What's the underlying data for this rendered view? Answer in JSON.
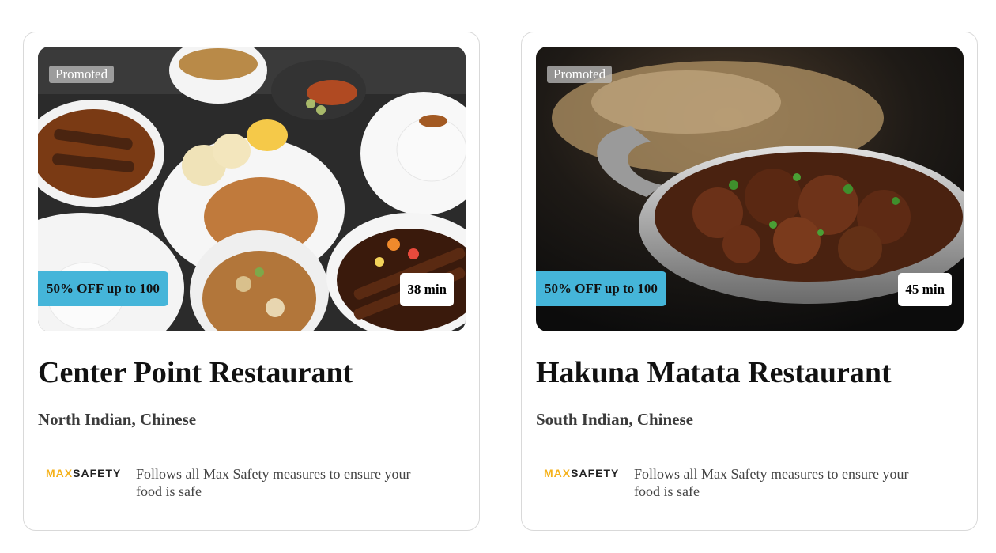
{
  "restaurants": [
    {
      "promoted_label": "Promoted",
      "offer": "50% OFF up to 100",
      "delivery_time": "38 min",
      "name": "Center Point Restaurant",
      "cuisines": "North Indian, Chinese",
      "safety_logo_max": "MAX",
      "safety_logo_safety": "SAFETY",
      "safety_text": "Follows all Max Safety measures to ensure your food is safe"
    },
    {
      "promoted_label": "Promoted",
      "offer": "50% OFF up to 100",
      "delivery_time": "45 min",
      "name": "Hakuna Matata Restaurant",
      "cuisines": "South Indian, Chinese",
      "safety_logo_max": "MAX",
      "safety_logo_safety": "SAFETY",
      "safety_text": "Follows all Max Safety measures to ensure your food is safe"
    }
  ],
  "colors": {
    "offer_badge": "#45b5d9",
    "logo_max": "#f5b21c"
  }
}
